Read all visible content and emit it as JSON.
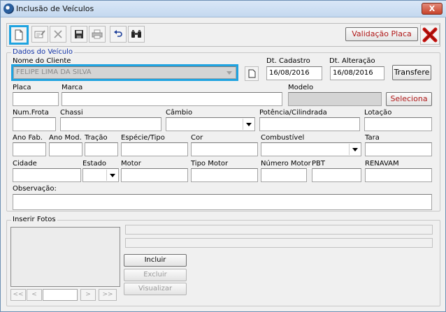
{
  "window": {
    "title": "Inclusão de Veículos",
    "close_glyph": "X"
  },
  "toolbar": {
    "icons": [
      "new-document-icon",
      "edit-icon",
      "delete-icon",
      "save-icon",
      "print-icon",
      "undo-icon",
      "search-binoculars-icon"
    ],
    "validacao_label": "Validação Placa",
    "exit_icon": "red-x-exit-icon"
  },
  "dados": {
    "group_title": "Dados do Veículo",
    "nome_cliente_label": "Nome do Cliente",
    "nome_cliente_value": "FELIPE LIMA DA SILVA",
    "dt_cadastro_label": "Dt. Cadastro",
    "dt_cadastro_value": "16/08/2016",
    "dt_alteracao_label": "Dt. Alteração",
    "dt_alteracao_value": "16/08/2016",
    "transfere_label": "Transfere",
    "placa_label": "Placa",
    "marca_label": "Marca",
    "modelo_label": "Modelo",
    "seleciona_label": "Seleciona",
    "num_frota_label": "Num.Frota",
    "chassi_label": "Chassi",
    "cambio_label": "Câmbio",
    "potencia_label": "Potência/Cilindrada",
    "lotacao_label": "Lotação",
    "ano_fab_label": "Ano Fab.",
    "ano_mod_label": "Ano Mod.",
    "tracao_label": "Tração",
    "especie_label": "Espécie/Tipo",
    "cor_label": "Cor",
    "combustivel_label": "Combustível",
    "tara_label": "Tara",
    "cidade_label": "Cidade",
    "estado_label": "Estado",
    "motor_label": "Motor",
    "tipo_motor_label": "Tipo Motor",
    "numero_motor_label": "Número Motor",
    "pbt_label": "PBT",
    "renavam_label": "RENAVAM",
    "observacao_label": "Observação:"
  },
  "fotos": {
    "group_title": "Inserir Fotos",
    "incluir_label": "Incluir",
    "excluir_label": "Excluir",
    "visualizar_label": "Visualizar",
    "nav_first": "<<",
    "nav_prev": "<",
    "nav_next": ">",
    "nav_last": ">>"
  }
}
